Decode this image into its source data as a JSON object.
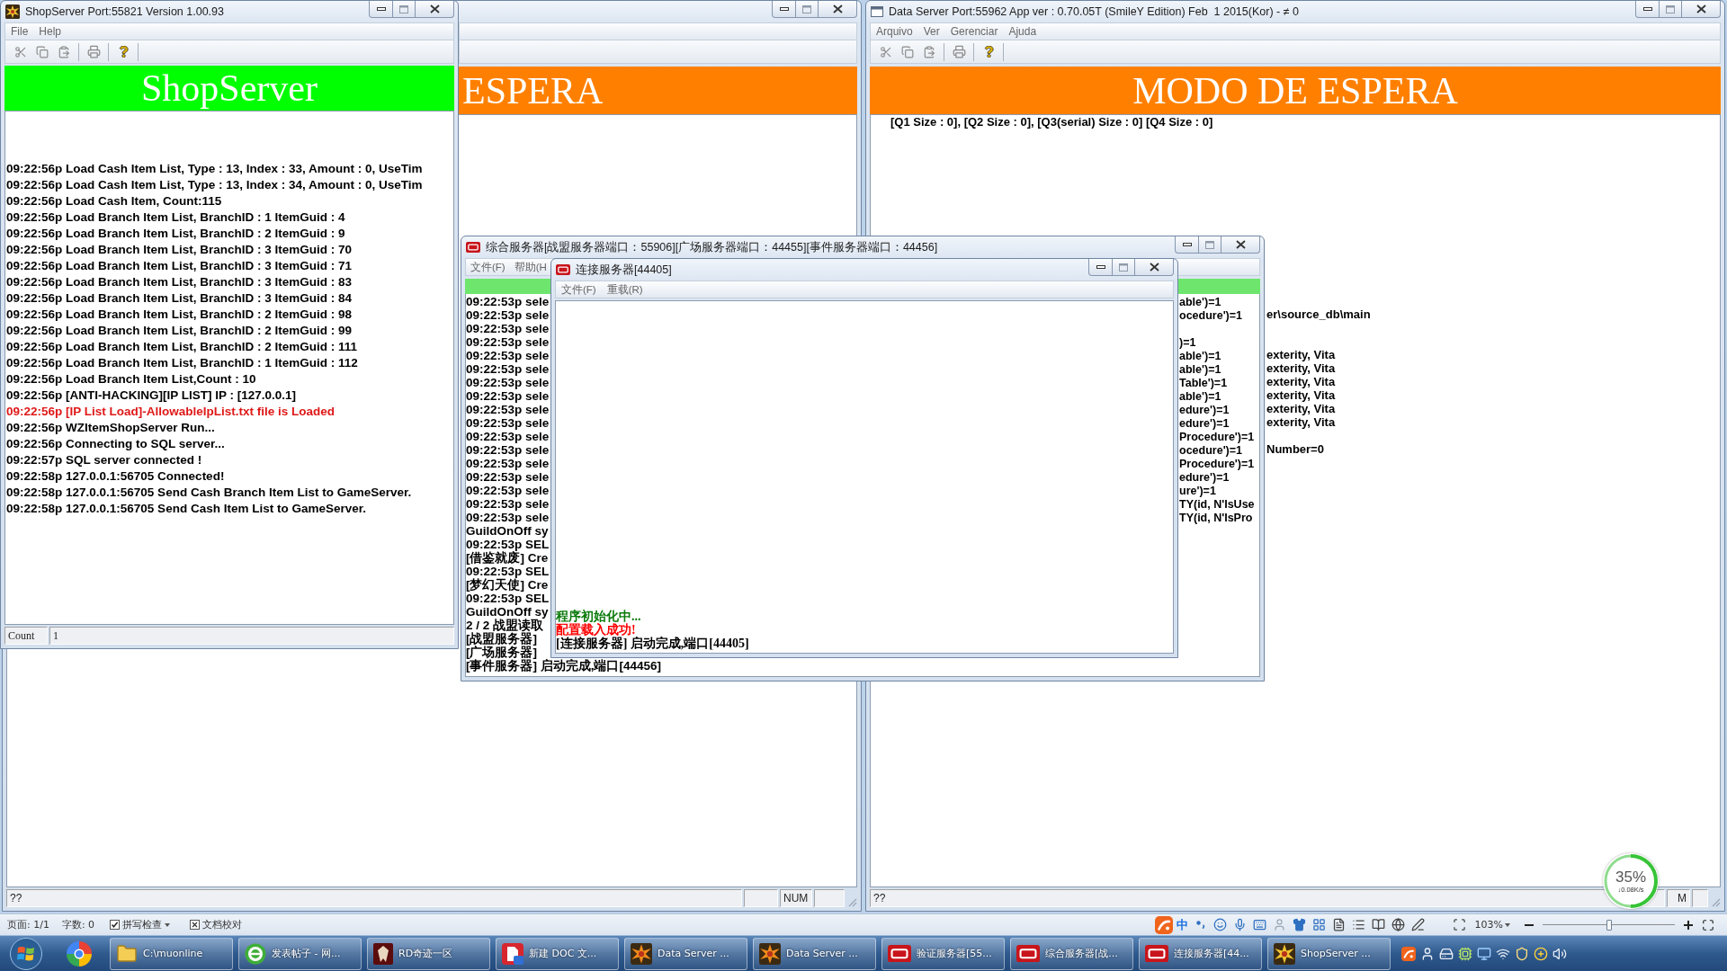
{
  "shop_server": {
    "title": "ShopServer Port:55821 Version 1.00.93",
    "menu": [
      "File",
      "Help"
    ],
    "banner": "ShopServer",
    "log": [
      {
        "text": "09:22:56p Load Cash Item List, Type : 13, Index : 33, Amount : 0, UseTim",
        "kind": "info"
      },
      {
        "text": "09:22:56p Load Cash Item List, Type : 13, Index : 34, Amount : 0, UseTim",
        "kind": "info"
      },
      {
        "text": "09:22:56p Load Cash Item, Count:115",
        "kind": "info"
      },
      {
        "text": "09:22:56p Load Branch Item List, BranchID : 1 ItemGuid : 4",
        "kind": "info"
      },
      {
        "text": "09:22:56p Load Branch Item List, BranchID : 2 ItemGuid : 9",
        "kind": "info"
      },
      {
        "text": "09:22:56p Load Branch Item List, BranchID : 3 ItemGuid : 70",
        "kind": "info"
      },
      {
        "text": "09:22:56p Load Branch Item List, BranchID : 3 ItemGuid : 71",
        "kind": "info"
      },
      {
        "text": "09:22:56p Load Branch Item List, BranchID : 3 ItemGuid : 83",
        "kind": "info"
      },
      {
        "text": "09:22:56p Load Branch Item List, BranchID : 3 ItemGuid : 84",
        "kind": "info"
      },
      {
        "text": "09:22:56p Load Branch Item List, BranchID : 2 ItemGuid : 98",
        "kind": "info"
      },
      {
        "text": "09:22:56p Load Branch Item List, BranchID : 2 ItemGuid : 99",
        "kind": "info"
      },
      {
        "text": "09:22:56p Load Branch Item List, BranchID : 2 ItemGuid : 111",
        "kind": "info"
      },
      {
        "text": "09:22:56p Load Branch Item List, BranchID : 1 ItemGuid : 112",
        "kind": "info"
      },
      {
        "text": "09:22:56p Load Branch Item List,Count : 10",
        "kind": "info"
      },
      {
        "text": "09:22:56p [ANTI-HACKING][IP LIST] IP : [127.0.0.1]",
        "kind": "info"
      },
      {
        "text": "09:22:56p [IP List Load]-AllowableIpList.txt file is Loaded",
        "kind": "error"
      },
      {
        "text": "09:22:56p WZItemShopServer Run...",
        "kind": "info"
      },
      {
        "text": "09:22:56p Connecting to SQL server...",
        "kind": "info"
      },
      {
        "text": "09:22:57p SQL server connected !",
        "kind": "info"
      },
      {
        "text": "09:22:58p 127.0.0.1:56705 Connected!",
        "kind": "info"
      },
      {
        "text": "09:22:58p 127.0.0.1:56705 Send Cash Branch Item List to GameServer.",
        "kind": "info"
      },
      {
        "text": "09:22:58p 127.0.0.1:56705 Send Cash Item List to GameServer.",
        "kind": "info"
      }
    ],
    "status": {
      "label": "Count",
      "value": "1"
    }
  },
  "data_server_behind": {
    "banner": "ESPERA",
    "status": {
      "text": "??",
      "indicator": "NUM"
    }
  },
  "data_server": {
    "title": "Data Server Port:55962 App ver : 0.70.05T (SmileY Edition) Feb  1 2015(Kor) - ≠ 0",
    "menu": [
      "Arquivo",
      "Ver",
      "Gerenciar",
      "Ajuda"
    ],
    "banner": "MODO DE ESPERA",
    "queue_status": "[Q1 Size : 0], [Q2 Size : 0], [Q3(serial) Size : 0] [Q4 Size : 0]",
    "log_fragments": [
      [
        "er\\source_db\\main"
      ],
      [
        "exterity, Vita",
        "exterity, Vita",
        "exterity, Vita",
        "exterity, Vita",
        "exterity, Vita",
        "exterity, Vita"
      ],
      [
        "Number=0"
      ]
    ],
    "status": {
      "text": "??",
      "indicator": "M"
    }
  },
  "combined_server": {
    "title": "综合服务器[战盟服务器端口：55906][广场服务器端口：44455][事件服务器端口：44456]",
    "menu": [
      "文件(F)",
      "帮助(H"
    ],
    "log": [
      {
        "left": "09:22:53p sele",
        "right": "able')=1"
      },
      {
        "left": "09:22:53p sele",
        "right": "ocedure')=1"
      },
      {
        "left": "09:22:53p sele"
      },
      {
        "left": "09:22:53p sele",
        "right": ")=1"
      },
      {
        "left": "09:22:53p sele",
        "right": "able')=1"
      },
      {
        "left": "09:22:53p sele",
        "right": "able')=1"
      },
      {
        "left": "09:22:53p sele",
        "right": "Table')=1"
      },
      {
        "left": "09:22:53p sele",
        "right": "able')=1"
      },
      {
        "left": "09:22:53p sele",
        "right": "edure')=1"
      },
      {
        "left": "09:22:53p sele",
        "right": "edure')=1"
      },
      {
        "left": "09:22:53p sele",
        "right": "Procedure')=1"
      },
      {
        "left": "09:22:53p sele",
        "right": "ocedure')=1"
      },
      {
        "left": "09:22:53p sele",
        "right": "Procedure')=1"
      },
      {
        "left": "09:22:53p sele",
        "right": "edure')=1"
      },
      {
        "left": "09:22:53p sele",
        "right": "ure')=1"
      },
      {
        "left": "09:22:53p sele",
        "right": "TY(id, N'IsUse"
      },
      {
        "left": "09:22:53p sele",
        "right": "TY(id, N'IsPro"
      },
      {
        "left": "GuildOnOff sy"
      },
      {
        "left": "09:22:53p SEL"
      },
      {
        "left": "[借鉴就废] Cre"
      },
      {
        "left": "09:22:53p SEL"
      },
      {
        "left": "[梦幻天使] Cre"
      },
      {
        "left": "09:22:53p SEL"
      },
      {
        "left": "GuildOnOff sy"
      },
      {
        "left": "2 / 2 战盟读取"
      },
      {
        "left": "[战盟服务器]"
      },
      {
        "left": "[广场服务器]"
      },
      {
        "left": "[事件服务器] 启动完成,端口[44456]"
      }
    ]
  },
  "connect_server": {
    "title": "连接服务器[44405]",
    "menu": [
      "文件(F)",
      "重载(R)"
    ],
    "log": [
      {
        "text": "程序初始化中...",
        "kind": "progress"
      },
      {
        "text": "配置载入成功!",
        "kind": "success"
      },
      {
        "text": "[连接服务器] 启动完成,端口[44405]",
        "kind": "info"
      }
    ]
  },
  "network_meter": {
    "percent": "35%",
    "speed": "↓0.08K/s"
  },
  "document_status_bar": {
    "page": "页面: 1/1",
    "word_count": "字数: 0",
    "spell_check": {
      "label": "拼写检查",
      "checked": true
    },
    "proofread": "文档校对",
    "ime_mode": "中",
    "zoom": {
      "reading": "103%",
      "level": 0.5
    }
  },
  "taskbar": {
    "items": [
      {
        "label": "C:\\muonline",
        "kind": "folder"
      },
      {
        "label": "发表帖子 - 网...",
        "kind": "disc"
      },
      {
        "label": "RD奇迹一区",
        "kind": "emblem"
      },
      {
        "label": "新建 DOC 文...",
        "kind": "document"
      },
      {
        "label": "Data Server ...",
        "kind": "server"
      },
      {
        "label": "Data Server ...",
        "kind": "server"
      },
      {
        "label": "验证服务器[55...",
        "kind": "tile"
      },
      {
        "label": "综合服务器[战...",
        "kind": "tile"
      },
      {
        "label": "连接服务器[44...",
        "kind": "tile"
      },
      {
        "label": "ShopServer ...",
        "kind": "shop"
      }
    ]
  }
}
